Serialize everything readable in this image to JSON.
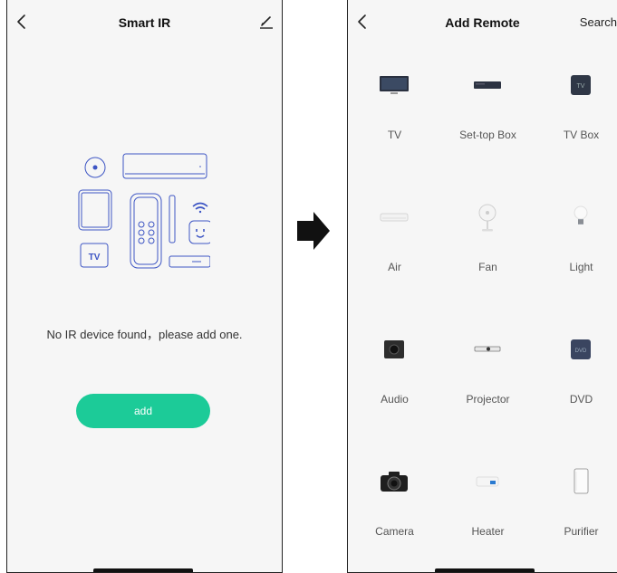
{
  "left_screen": {
    "title": "Smart IR",
    "empty_message": "No IR device found，please add one.",
    "add_button_label": "add",
    "illustration_tv_label": "TV"
  },
  "right_screen": {
    "title": "Add Remote",
    "search_label": "Search",
    "devices": [
      {
        "label": "TV",
        "icon": "tv-icon"
      },
      {
        "label": "Set-top Box",
        "icon": "set-top-box-icon"
      },
      {
        "label": "TV Box",
        "icon": "tv-box-icon"
      },
      {
        "label": "Air",
        "icon": "air-conditioner-icon"
      },
      {
        "label": "Fan",
        "icon": "fan-icon"
      },
      {
        "label": "Light",
        "icon": "light-bulb-icon"
      },
      {
        "label": "Audio",
        "icon": "speaker-icon"
      },
      {
        "label": "Projector",
        "icon": "projector-icon"
      },
      {
        "label": "DVD",
        "icon": "dvd-icon"
      },
      {
        "label": "Camera",
        "icon": "camera-icon"
      },
      {
        "label": "Heater",
        "icon": "heater-icon"
      },
      {
        "label": "Purifier",
        "icon": "purifier-icon"
      }
    ],
    "tv_box_badge": "TV",
    "dvd_badge": "DVD"
  },
  "colors": {
    "accent": "#1ccb98",
    "illustration_stroke": "#3d55c4"
  }
}
